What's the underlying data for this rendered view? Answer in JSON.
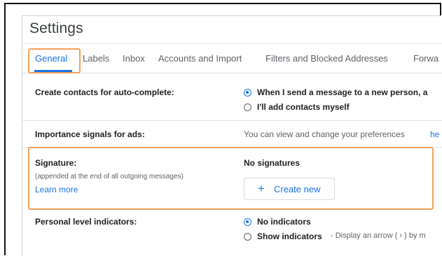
{
  "settings": {
    "title": "Settings",
    "tabs": [
      {
        "label": "General",
        "active": true
      },
      {
        "label": "Labels"
      },
      {
        "label": "Inbox"
      },
      {
        "label": "Accounts and Import"
      },
      {
        "label": "Filters and Blocked Addresses"
      },
      {
        "label": "Forwa"
      }
    ]
  },
  "rows": {
    "contacts": {
      "label": "Create contacts for auto-complete:",
      "options": [
        {
          "text": "When I send a message to a new person, a",
          "selected": true
        },
        {
          "text": "I'll add contacts myself",
          "selected": false
        }
      ]
    },
    "importance": {
      "label": "Importance signals for ads:",
      "text": "You can view and change your preferences",
      "link": "he"
    },
    "signature": {
      "label": "Signature:",
      "note": "(appended at the end of all outgoing messages)",
      "learn_more": "Learn more",
      "status": "No signatures",
      "create_button": "Create new",
      "create_icon": "plus-icon"
    },
    "personal": {
      "label": "Personal level indicators:",
      "options": [
        {
          "text": "No indicators",
          "selected": true
        },
        {
          "text": "Show indicators",
          "selected": false,
          "description": "- Display an arrow ( › ) by m"
        }
      ]
    }
  },
  "colors": {
    "accent": "#1a73e8",
    "highlight": "#f5a05b",
    "text": "#202124",
    "muted": "#5f6368"
  }
}
